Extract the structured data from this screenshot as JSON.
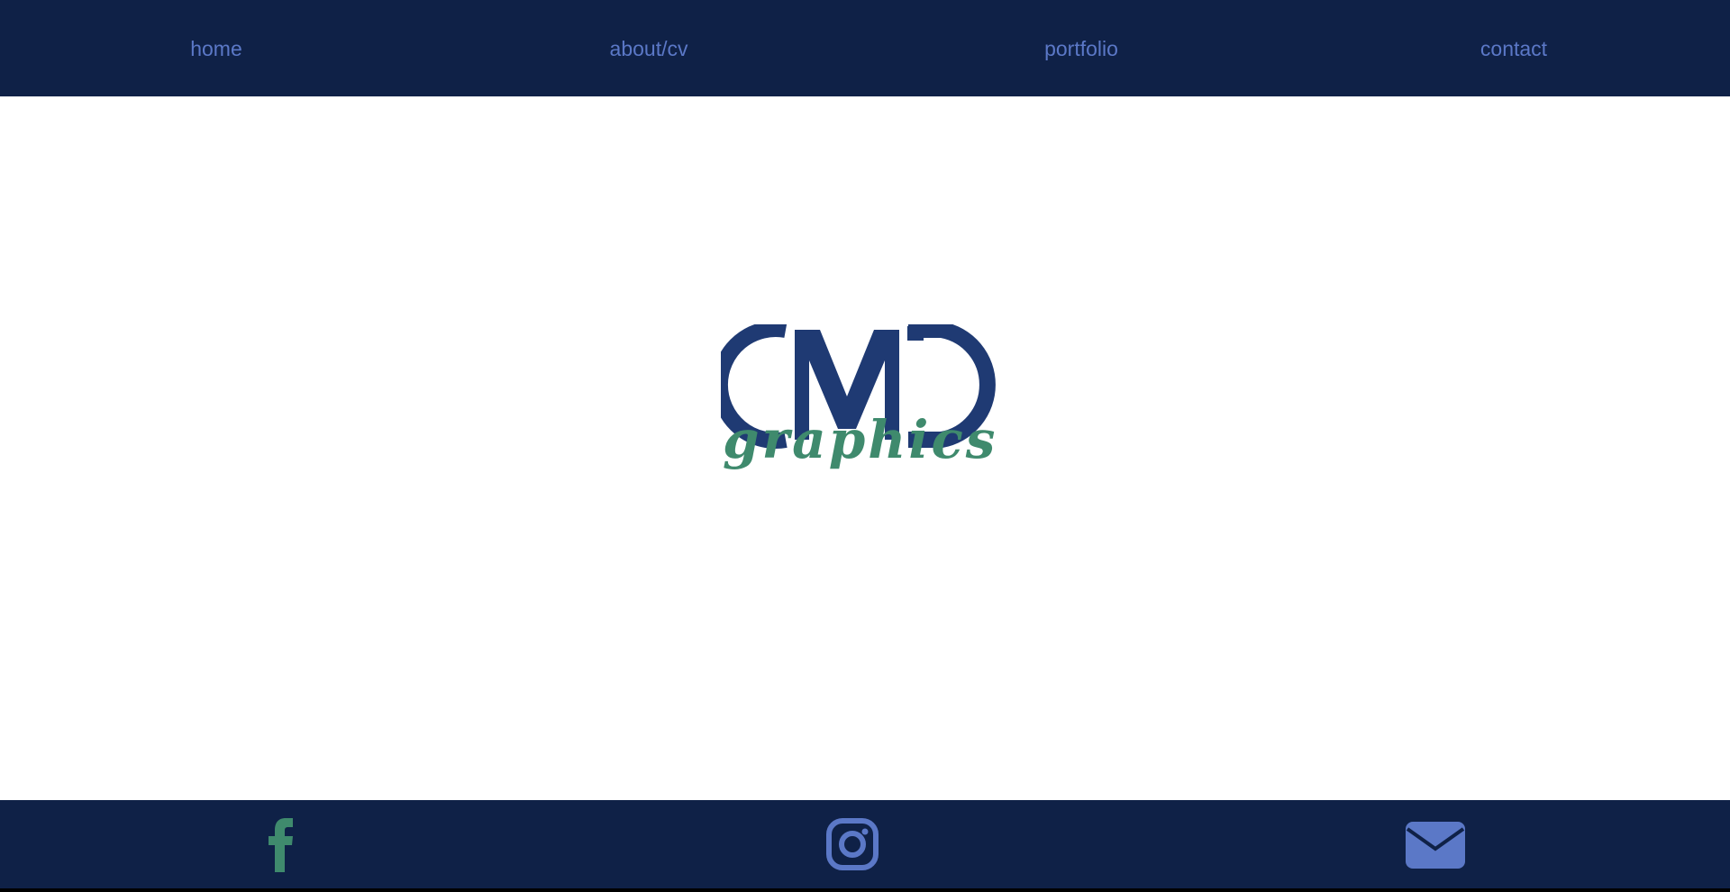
{
  "nav": {
    "items": [
      {
        "label": "home"
      },
      {
        "label": "about/cv"
      },
      {
        "label": "portfolio"
      },
      {
        "label": "contact"
      }
    ]
  },
  "logo": {
    "text": "CMD graphics",
    "primary_color": "#1f3a73",
    "script_color": "#3f8a6d"
  },
  "footer": {
    "icons": [
      "facebook-icon",
      "instagram-icon",
      "mail-icon"
    ]
  },
  "colors": {
    "nav_bg": "#0f2147",
    "nav_text": "#5b78c7",
    "facebook": "#3f8a6d",
    "instagram": "#5b78c7",
    "mail": "#5b78c7"
  }
}
